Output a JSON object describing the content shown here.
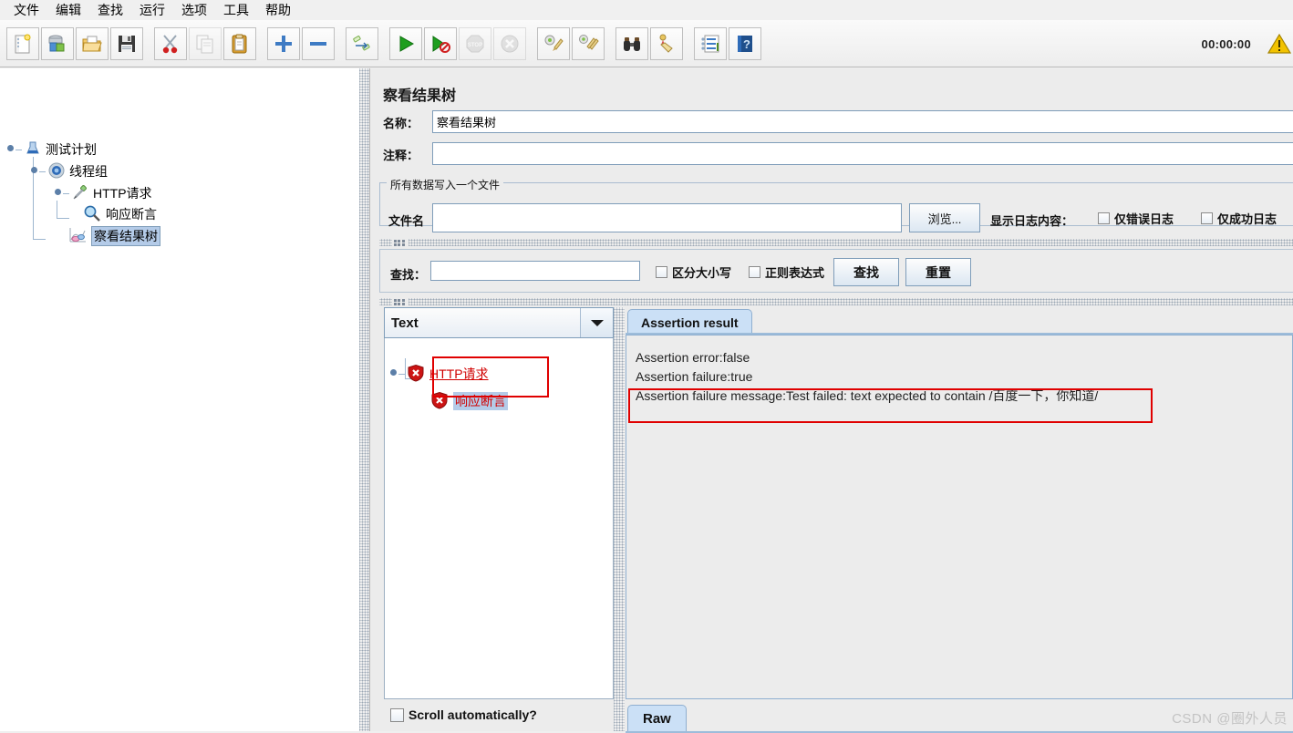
{
  "menu": {
    "items": [
      {
        "label": "文件",
        "name": "menu-file"
      },
      {
        "label": "编辑",
        "name": "menu-edit"
      },
      {
        "label": "查找",
        "name": "menu-search"
      },
      {
        "label": "运行",
        "name": "menu-run"
      },
      {
        "label": "选项",
        "name": "menu-options"
      },
      {
        "label": "工具",
        "name": "menu-tools"
      },
      {
        "label": "帮助",
        "name": "menu-help"
      }
    ]
  },
  "toolbar": {
    "icons": [
      "new-document-icon",
      "templates-icon",
      "open-folder-icon",
      "save-icon",
      "cut-scissors-icon",
      "copy-icon",
      "paste-clipboard-icon",
      "expand-plus-icon",
      "collapse-minus-icon",
      "toggle-icon",
      "start-run-icon",
      "start-no-pauses-icon",
      "stop-icon",
      "shutdown-icon",
      "clear-icon",
      "clear-all-icon",
      "search-binoculars-icon",
      "reset-search-icon",
      "function-helper-icon",
      "help-book-icon"
    ],
    "timer": "00:00:00",
    "warning_icon": "warning-triangle-icon"
  },
  "tree": {
    "nodes": [
      {
        "label": "测试计划",
        "icon": "test-plan-icon",
        "selected": false
      },
      {
        "label": "线程组",
        "icon": "thread-group-icon",
        "selected": false
      },
      {
        "label": "HTTP请求",
        "icon": "http-request-icon",
        "selected": false
      },
      {
        "label": "响应断言",
        "icon": "response-assertion-icon",
        "selected": false
      },
      {
        "label": "察看结果树",
        "icon": "view-results-tree-icon",
        "selected": true
      }
    ]
  },
  "main": {
    "title": "察看结果树",
    "name_label": "名称：",
    "name_value": "察看结果树",
    "comment_label": "注释：",
    "comment_value": "",
    "file_group": {
      "title": "所有数据写入一个文件",
      "filename_label": "文件名",
      "filename_value": "",
      "browse_button": "浏览...",
      "log_display_label": "显示日志内容：",
      "errors_only": "仅错误日志",
      "successes_only": "仅成功日志"
    },
    "search_bar": {
      "label": "查找：",
      "value": "",
      "case_sensitive": "区分大小写",
      "regex": "正则表达式",
      "search_button": "查找",
      "reset_button": "重置"
    },
    "results": {
      "renderer_selected": "Text",
      "tree": [
        {
          "label": "HTTP请求",
          "icon": "error-shield-icon",
          "highlighted": false
        },
        {
          "label": "响应断言",
          "icon": "error-shield-icon",
          "highlighted": true
        }
      ],
      "scroll_automatically": "Scroll automatically?"
    },
    "detail": {
      "tabs": [
        {
          "label": "Assertion result",
          "active": true
        }
      ],
      "assertion_lines": [
        "Assertion error:false",
        "Assertion failure:true",
        "Assertion failure message:Test failed: text expected to contain /百度一下，你知道/"
      ],
      "bottom_tabs": [
        {
          "label": "Raw",
          "active": true
        }
      ]
    }
  },
  "watermark": "CSDN @圈外人员",
  "colors": {
    "accent": "#B4CBE8",
    "annotation": "#E00000",
    "error_text": "#D00000",
    "tab_active": "#CBE0F6",
    "panel_bg": "#ECECEC"
  }
}
